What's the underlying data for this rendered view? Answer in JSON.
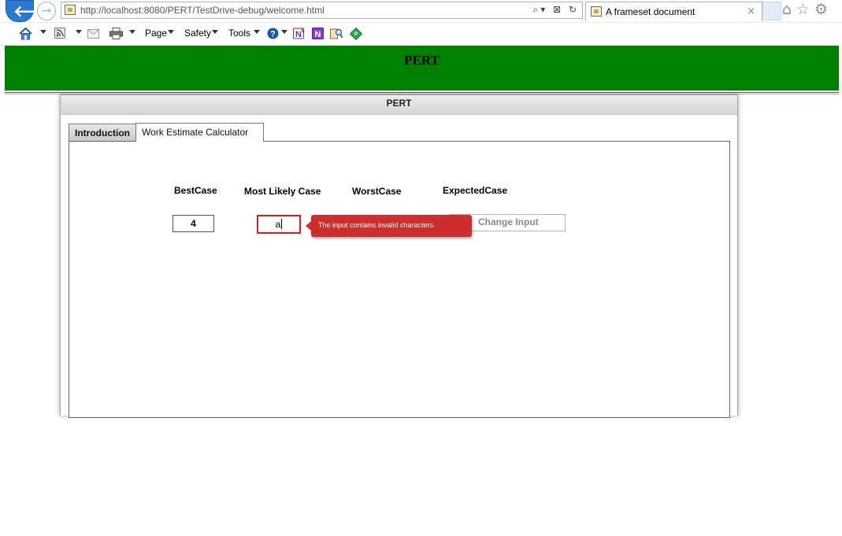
{
  "browser": {
    "url": "http://localhost:8080/PERT/TestDrive-debug/welcome.html",
    "tab_title": "A frameset document",
    "tab_close": "×",
    "back_glyph": "🡐",
    "forward_glyph": "→",
    "address_icons": "⌕▾ ⊠ ↻",
    "right_icons": "⌂☆⚙",
    "commandbar": {
      "page_label": "Page",
      "safety_label": "Safety",
      "tools_label": "Tools",
      "icons": [
        "home-icon",
        "feeds-icon",
        "read-mail-icon",
        "print-icon",
        "help-icon",
        "onenote-icon",
        "onenote-linked-icon",
        "research-icon",
        "add-on-icon"
      ]
    }
  },
  "header": {
    "title": "PERT"
  },
  "panel": {
    "title": "PERT",
    "tabs": [
      {
        "label": "Introduction",
        "active": false
      },
      {
        "label": "Work Estimate Calculator",
        "active": true
      }
    ]
  },
  "calculator": {
    "labels": {
      "best": "BestCase",
      "likely": "Most Likely Case",
      "worst": "WorstCase",
      "expected": "ExpectedCase"
    },
    "best_value": "4",
    "likely_value": "a",
    "button_label": "Change Input",
    "error_message": "The input contains invalid characters."
  },
  "colors": {
    "header_green": "#008000",
    "error_red": "#cc2d2d",
    "invalid_border": "#e21b1b",
    "ie_blue": "#2a78cf"
  }
}
